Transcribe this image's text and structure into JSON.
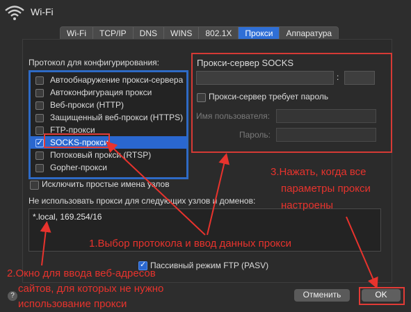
{
  "window": {
    "title": "Wi-Fi"
  },
  "tabs": [
    {
      "label": "Wi-Fi"
    },
    {
      "label": "TCP/IP"
    },
    {
      "label": "DNS"
    },
    {
      "label": "WINS"
    },
    {
      "label": "802.1X"
    },
    {
      "label": "Прокси"
    },
    {
      "label": "Аппаратура"
    }
  ],
  "protocols": {
    "heading": "Протокол для конфигурирования:",
    "items": [
      {
        "label": "Автообнаружение прокси-сервера",
        "checked": false
      },
      {
        "label": "Автоконфигурация прокси",
        "checked": false
      },
      {
        "label": "Веб-прокси (HTTP)",
        "checked": false
      },
      {
        "label": "Защищенный веб-прокси (HTTPS)",
        "checked": false
      },
      {
        "label": "FTP-прокси",
        "checked": false
      },
      {
        "label": "SOCKS-прокси",
        "checked": true
      },
      {
        "label": "Потоковый прокси (RTSP)",
        "checked": false
      },
      {
        "label": "Gopher-прокси",
        "checked": false
      }
    ]
  },
  "socks": {
    "heading": "Прокси-сервер SOCKS",
    "colon": ":",
    "requires_password": "Прокси-сервер требует пароль",
    "username_label": "Имя пользователя:",
    "password_label": "Пароль:"
  },
  "exclude_simple": "Исключить простые имена узлов",
  "bypass": {
    "label": "Не использовать прокси для следующих узлов и доменов:",
    "value": "*.local, 169.254/16"
  },
  "pasv": "Пассивный режим FTP (PASV)",
  "buttons": {
    "help": "?",
    "cancel": "Отменить",
    "ok": "OK"
  },
  "annotations": {
    "one": "1.Выбор протокола и ввод данных прокси",
    "two_line1": "2.Окно для ввода веб-адресов",
    "two_line2": "сайтов, для которых не нужно",
    "two_line3": "использование прокси",
    "three_line1": "3.Нажать, когда все",
    "three_line2": "параметры прокси",
    "three_line3": "настроены",
    "color": "#e8332d"
  }
}
